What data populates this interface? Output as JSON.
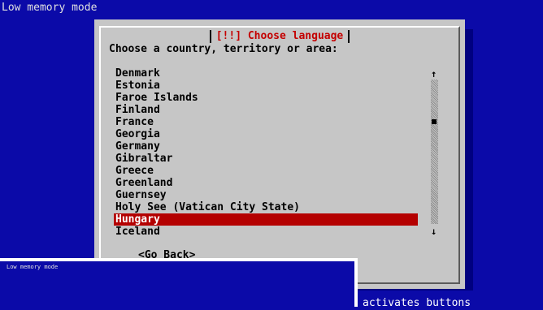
{
  "top_status": "Low memory mode",
  "dialog": {
    "title": "[!!] Choose language",
    "prompt": "Choose a country, territory or area:",
    "items": [
      "Denmark",
      "Estonia",
      "Faroe Islands",
      "Finland",
      "France",
      "Georgia",
      "Germany",
      "Gibraltar",
      "Greece",
      "Greenland",
      "Guernsey",
      "Holy See (Vatican City State)",
      "Hungary",
      "Iceland"
    ],
    "selected_item": "Hungary",
    "go_back_label": "<Go Back>",
    "scroll_up_icon": "arrow-up",
    "scroll_down_icon": "arrow-down"
  },
  "overlay": {
    "title": "Low memory mode"
  },
  "bottom_hint": "activates buttons",
  "colors": {
    "background": "#0b0aa8",
    "dialog_bg": "#c6c6c6",
    "title_text": "#c40000",
    "selection": "#b40000"
  }
}
